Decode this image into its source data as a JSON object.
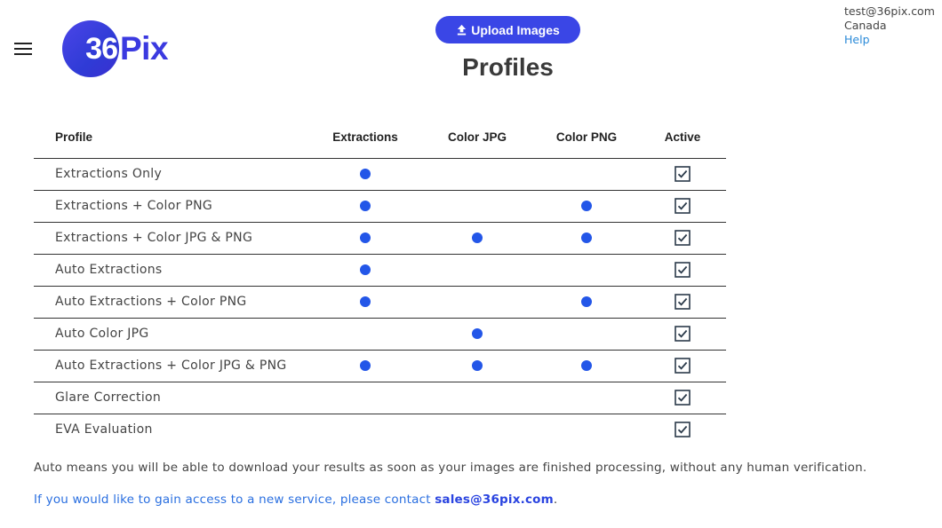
{
  "header": {
    "logo_number": "36",
    "logo_text": "Pix",
    "upload_label": "Upload Images",
    "page_title": "Profiles"
  },
  "user": {
    "email": "test@36pix.com",
    "country": "Canada",
    "help_label": "Help"
  },
  "table": {
    "columns": [
      "Profile",
      "Extractions",
      "Color JPG",
      "Color PNG",
      "Active"
    ],
    "rows": [
      {
        "name": "Extractions Only",
        "extractions": true,
        "color_jpg": false,
        "color_png": false,
        "active": true
      },
      {
        "name": "Extractions + Color PNG",
        "extractions": true,
        "color_jpg": false,
        "color_png": true,
        "active": true
      },
      {
        "name": "Extractions + Color JPG & PNG",
        "extractions": true,
        "color_jpg": true,
        "color_png": true,
        "active": true
      },
      {
        "name": "Auto Extractions",
        "extractions": true,
        "color_jpg": false,
        "color_png": false,
        "active": true
      },
      {
        "name": "Auto Extractions + Color PNG",
        "extractions": true,
        "color_jpg": false,
        "color_png": true,
        "active": true
      },
      {
        "name": "Auto Color JPG",
        "extractions": false,
        "color_jpg": true,
        "color_png": false,
        "active": true
      },
      {
        "name": "Auto Extractions + Color JPG & PNG",
        "extractions": true,
        "color_jpg": true,
        "color_png": true,
        "active": true
      },
      {
        "name": "Glare Correction",
        "extractions": false,
        "color_jpg": false,
        "color_png": false,
        "active": true
      },
      {
        "name": "EVA Evaluation",
        "extractions": false,
        "color_jpg": false,
        "color_png": false,
        "active": true
      }
    ]
  },
  "footer": {
    "auto_note": "Auto means you will be able to download your results as soon as your images are finished processing, without any human verification.",
    "contact_prefix": "If you would like to gain access to a new service, please contact ",
    "contact_email": "sales@36pix.com",
    "contact_suffix": "."
  },
  "colors": {
    "accent": "#3a46e6",
    "dot": "#2356e8",
    "link": "#2a8ad8"
  },
  "icons": {
    "menu": "hamburger-icon",
    "upload": "upload-arrow-icon",
    "feature": "dot-indicator-icon",
    "active": "checked-checkbox-icon"
  }
}
